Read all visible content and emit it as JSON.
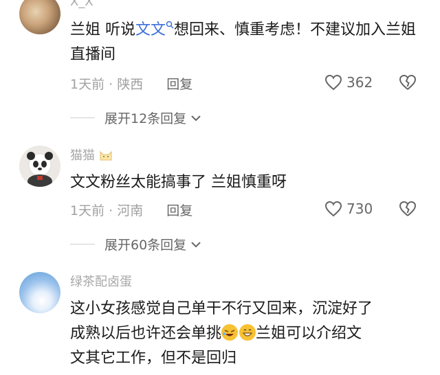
{
  "comments": [
    {
      "username": "X_X",
      "text_before": "兰姐 听说",
      "link_text": "文文",
      "text_after": "想回来、慎重考虑！不建议加入兰姐直播间",
      "time": "1天前",
      "location": "陕西",
      "reply_label": "回复",
      "likes": "362",
      "expand_label": "展开12条回复"
    },
    {
      "username": "猫猫",
      "text": "文文粉丝太能搞事了 兰姐慎重呀",
      "time": "1天前",
      "location": "河南",
      "reply_label": "回复",
      "likes": "730",
      "expand_label": "展开60条回复"
    },
    {
      "username": "绿茶配卤蛋",
      "text_line1": "这小女孩感觉自己单干不行又回来，沉淀好了",
      "text_line2a": "成熟以后也许还会单挑",
      "text_line2b": "兰姐可以介绍文",
      "text_line3": "文其它工作，但不是回归"
    }
  ],
  "icons": {
    "like": "heart-outline-icon",
    "dislike": "broken-heart-icon",
    "expand": "chevron-down-icon",
    "search": "search-icon",
    "emoji1": "rolling-laughing-emoji-icon",
    "emoji2": "grinning-emoji-icon"
  }
}
